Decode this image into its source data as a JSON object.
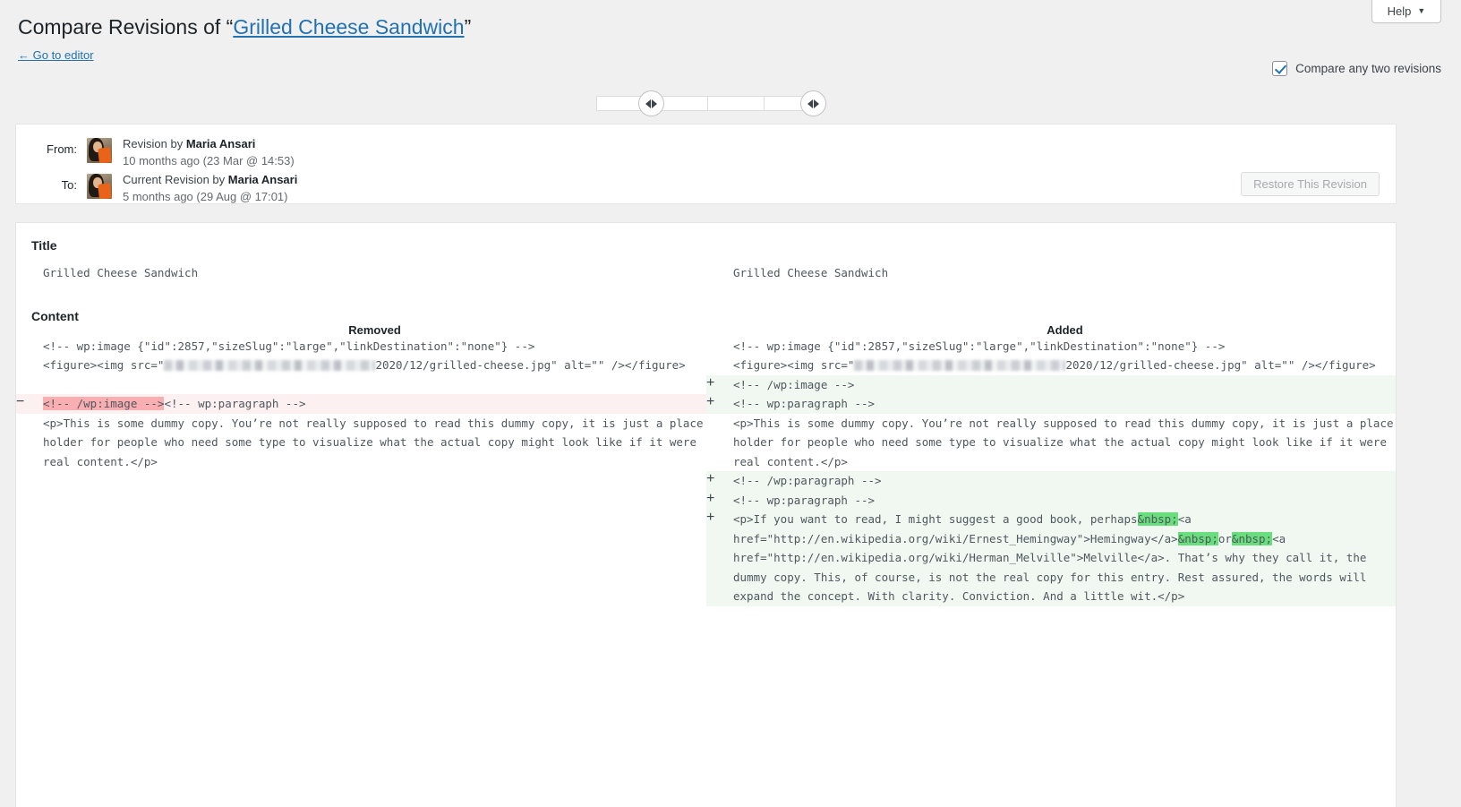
{
  "help": {
    "label": "Help",
    "caret": "▼",
    "icon": "chevron-down-icon"
  },
  "header": {
    "title_prefix": "Compare Revisions of “",
    "title_link": "Grilled Cheese Sandwich",
    "title_suffix": "”",
    "back_link": "← Go to editor"
  },
  "compare_toggle": {
    "label": "Compare any two revisions",
    "checked": true
  },
  "revisions": {
    "from": {
      "label": "From:",
      "byline": "Revision by ",
      "author": "Maria Ansari",
      "when": "10 months ago (23 Mar @ 14:53)"
    },
    "to": {
      "label": "To:",
      "byline": "Current Revision by ",
      "author": "Maria Ansari",
      "when": "5 months ago (29 Aug @ 17:01)"
    },
    "restore_label": "Restore This Revision"
  },
  "fields": {
    "title_heading": "Title",
    "content_heading": "Content",
    "removed_heading": "Removed",
    "added_heading": "Added",
    "title_left": "Grilled Cheese Sandwich",
    "title_right": "Grilled Cheese Sandwich"
  },
  "diff": {
    "rows": [
      {
        "type": "context",
        "left": "<!-- wp:image {\"id\":2857,\"sizeSlug\":\"large\",\"linkDestination\":\"none\"} -->",
        "right": "<!-- wp:image {\"id\":2857,\"sizeSlug\":\"large\",\"linkDestination\":\"none\"} -->"
      },
      {
        "type": "context-redacted",
        "left_pre": "<figure><img src=\"",
        "left_post": "2020/12/grilled-cheese.jpg\" alt=\"\" /></figure>",
        "right_pre": "<figure><img src=\"",
        "right_post": "2020/12/grilled-cheese.jpg\" alt=\"\" /></figure>"
      },
      {
        "type": "added",
        "marker": "+",
        "right": "<!-- /wp:image -->"
      },
      {
        "type": "removed-added",
        "del_marker": "−",
        "ins_marker": "+",
        "left_hl": "<!-- /wp:image -->",
        "left_rest": "<!-- wp:paragraph -->",
        "right": "<!-- wp:paragraph -->"
      },
      {
        "type": "context",
        "left": "<p>This is some dummy copy. You’re not really supposed to read this dummy copy, it is just a place holder for people who need some type to visualize what the actual copy might look like if it were real content.</p>",
        "right": "<p>This is some dummy copy. You’re not really supposed to read this dummy copy, it is just a place holder for people who need some type to visualize what the actual copy might look like if it were real content.</p>"
      },
      {
        "type": "added",
        "marker": "+",
        "right": "<!-- /wp:paragraph -->"
      },
      {
        "type": "added",
        "marker": "+",
        "right": "<!-- wp:paragraph -->"
      },
      {
        "type": "added-rich",
        "marker": "+",
        "segments": [
          {
            "text": "<p>If you want to read, I might suggest a good book, perhaps",
            "hl": false
          },
          {
            "text": "&nbsp;",
            "hl": true
          },
          {
            "text": "<a href=\"http://en.wikipedia.org/wiki/Ernest_Hemingway\">Hemingway</a>",
            "hl": false
          },
          {
            "text": "&nbsp;",
            "hl": true
          },
          {
            "text": "or",
            "hl": false
          },
          {
            "text": "&nbsp;",
            "hl": true
          },
          {
            "text": "<a href=\"http://en.wikipedia.org/wiki/Herman_Melville\">Melville</a>. That’s why they call it, the dummy copy. This, of course, is not the real copy for this entry. Rest assured, the words will expand the concept. With clarity. Conviction. And a little wit.</p>",
            "hl": false
          }
        ]
      }
    ]
  },
  "colors": {
    "accent": "#2271b1",
    "removed_bg": "#fcf0f1",
    "removed_hl": "#f9aeb2",
    "added_bg": "#f0f8f1",
    "added_hl": "#68de7c",
    "page_bg": "#f0f0f1"
  }
}
